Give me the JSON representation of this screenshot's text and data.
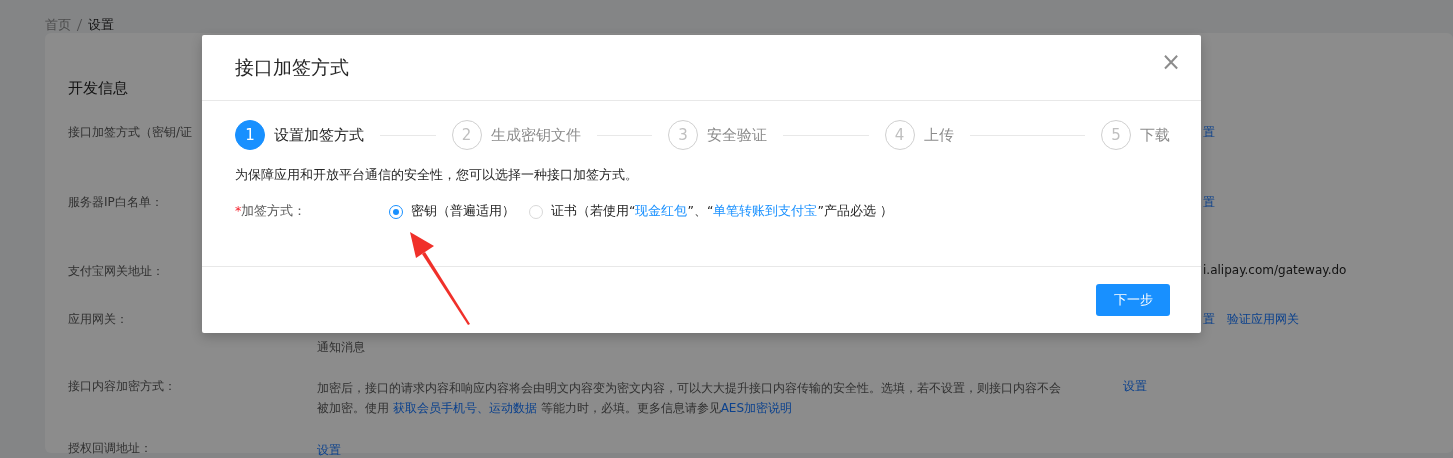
{
  "breadcrumb": [
    {
      "label": "首页",
      "selected": false
    },
    {
      "label": "设置",
      "selected": true
    }
  ],
  "panel": {
    "title": "开发信息",
    "rows": [
      {
        "kind": "covered",
        "label": "接口加签方式（密钥/证",
        "value": [],
        "actions": [
          "置"
        ]
      },
      {
        "kind": "covered",
        "label": "服务器IP白名单：",
        "value": [],
        "actions": [
          "置"
        ]
      },
      {
        "kind": "covered",
        "label": "支付宝网关地址：",
        "value": [],
        "url": "i.alipay.com/gateway.do",
        "actions": []
      },
      {
        "kind": "covered",
        "label": "应用网关：",
        "value": [
          {
            "kind": "text",
            "text": "通知消息"
          }
        ],
        "actions": [
          "置",
          "验证应用网关"
        ]
      },
      {
        "kind": "plain",
        "label": "接口内容加密方式：",
        "value": [
          {
            "kind": "text",
            "text": "加密后，接口的请求内容和响应内容将会由明文内容变为密文内容，可以大大提升接口内容传输的安全性。选填，若不设置，则接口内容不会被加密。使用 "
          },
          {
            "kind": "link",
            "text": "获取会员手机号、运动数据"
          },
          {
            "kind": "text",
            "text": " 等能力时，必填。更多信息请参见"
          },
          {
            "kind": "link",
            "text": "AES加密说明"
          }
        ],
        "actions": [
          "设置"
        ]
      },
      {
        "kind": "plain",
        "label": "授权回调地址：",
        "value": [
          {
            "kind": "link",
            "text": "设置"
          }
        ],
        "actions": []
      }
    ]
  },
  "dialog": {
    "title": "接口加签方式",
    "close": "×",
    "steps": [
      {
        "number": "1",
        "label": "设置加签方式",
        "selected": true
      },
      {
        "number": "2",
        "label": "生成密钥文件",
        "selected": false
      },
      {
        "number": "3",
        "label": "安全验证",
        "selected": false
      },
      {
        "number": "4",
        "label": "上传",
        "selected": false
      },
      {
        "number": "5",
        "label": "下载",
        "selected": false
      }
    ],
    "description": "为保障应用和开放平台通信的安全性，您可以选择一种接口加签方式。",
    "field": {
      "required": "*",
      "label": "加签方式：",
      "options": [
        {
          "selected": true,
          "parts": [
            {
              "kind": "text",
              "text": "密钥（普遍适用）"
            }
          ]
        },
        {
          "selected": false,
          "parts": [
            {
              "kind": "text",
              "text": "证书（若使用“"
            },
            {
              "kind": "link",
              "text": "现金红包"
            },
            {
              "kind": "text",
              "text": "”、“"
            },
            {
              "kind": "link",
              "text": "单笔转账到支付宝"
            },
            {
              "kind": "text",
              "text": "”产品必选 ）"
            }
          ]
        }
      ]
    },
    "next_button": "下一步"
  }
}
